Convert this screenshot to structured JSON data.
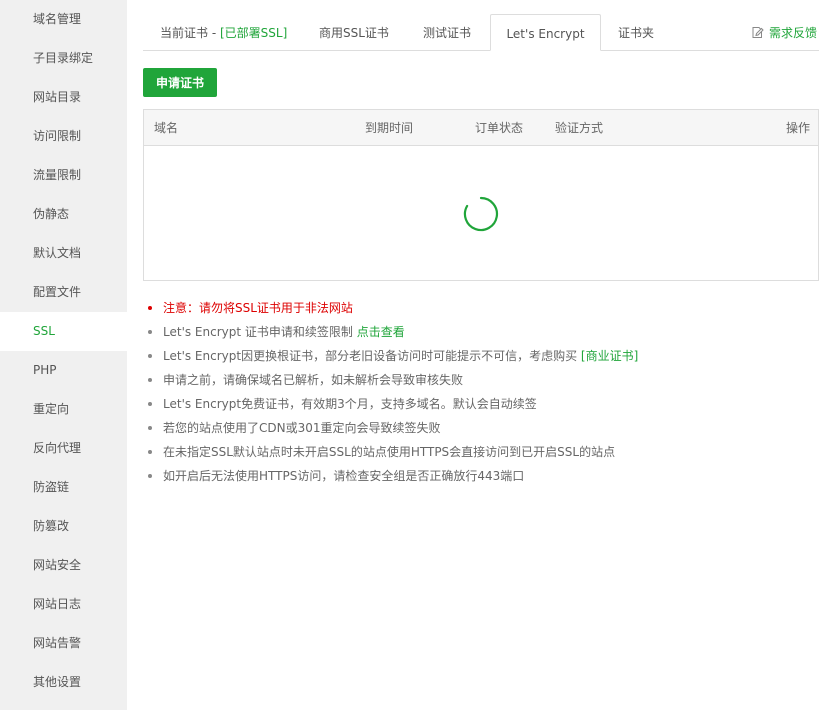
{
  "sidebar": {
    "items": [
      {
        "label": "域名管理"
      },
      {
        "label": "子目录绑定"
      },
      {
        "label": "网站目录"
      },
      {
        "label": "访问限制"
      },
      {
        "label": "流量限制"
      },
      {
        "label": "伪静态"
      },
      {
        "label": "默认文档"
      },
      {
        "label": "配置文件"
      },
      {
        "label": "SSL"
      },
      {
        "label": "PHP"
      },
      {
        "label": "重定向"
      },
      {
        "label": "反向代理"
      },
      {
        "label": "防盗链"
      },
      {
        "label": "防篡改"
      },
      {
        "label": "网站安全"
      },
      {
        "label": "网站日志"
      },
      {
        "label": "网站告警"
      },
      {
        "label": "其他设置"
      }
    ],
    "active_index": 8
  },
  "tabs": {
    "current_prefix": "当前证书 - ",
    "current_status": "[已部署SSL]",
    "commercial": "商用SSL证书",
    "test": "测试证书",
    "letsencrypt": "Let's Encrypt",
    "folder": "证书夹",
    "active": "Let's Encrypt"
  },
  "feedback": {
    "label": "需求反馈",
    "icon": "edit-icon"
  },
  "apply_button": "申请证书",
  "table": {
    "headers": {
      "domain": "域名",
      "expire": "到期时间",
      "order_status": "订单状态",
      "verify": "验证方式",
      "action": "操作"
    },
    "rows": [],
    "loading": true
  },
  "notes": [
    {
      "text": "注意：请勿将SSL证书用于非法网站"
    },
    {
      "text": "Let's Encrypt 证书申请和续签限制 ",
      "link": "点击查看"
    },
    {
      "text": "Let's Encrypt因更换根证书，部分老旧设备访问时可能提示不可信，考虑购买 ",
      "link": "[商业证书]"
    },
    {
      "text": "申请之前，请确保域名已解析，如未解析会导致审核失败"
    },
    {
      "text": "Let's Encrypt免费证书，有效期3个月，支持多域名。默认会自动续签"
    },
    {
      "text": "若您的站点使用了CDN或301重定向会导致续签失败"
    },
    {
      "text": "在未指定SSL默认站点时未开启SSL的站点使用HTTPS会直接访问到已开启SSL的站点"
    },
    {
      "text": "如开启后无法使用HTTPS访问，请检查安全组是否正确放行443端口"
    }
  ],
  "colors": {
    "accent": "#20a53a",
    "warning": "#dd0000",
    "sidebar_bg": "#f0f0f0",
    "border": "#dddddd"
  }
}
